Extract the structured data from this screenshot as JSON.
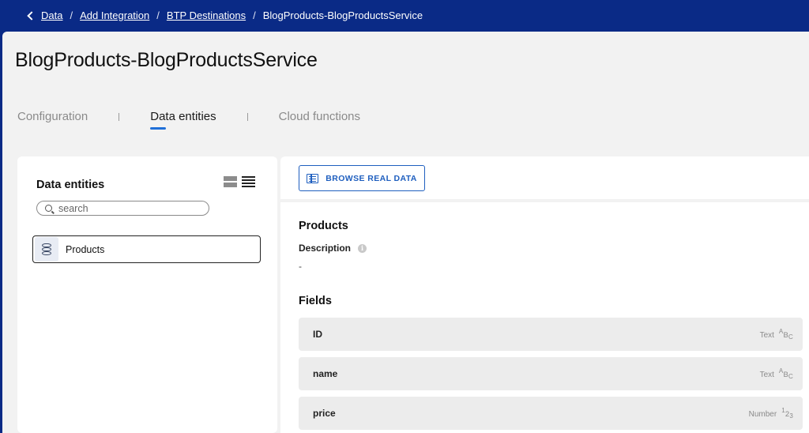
{
  "breadcrumb": {
    "items": [
      "Data",
      "Add Integration",
      "BTP Destinations"
    ],
    "current": "BlogProducts-BlogProductsService"
  },
  "page": {
    "title": "BlogProducts-BlogProductsService"
  },
  "tabs": [
    {
      "label": "Configuration",
      "active": false
    },
    {
      "label": "Data entities",
      "active": true
    },
    {
      "label": "Cloud functions",
      "active": false
    }
  ],
  "entities_panel": {
    "title": "Data entities",
    "search_placeholder": "search",
    "items": [
      {
        "label": "Products",
        "icon": "database-icon"
      }
    ]
  },
  "toolbar": {
    "browse_label": "BROWSE REAL DATA"
  },
  "entity_detail": {
    "name": "Products",
    "description_label": "Description",
    "description_value": "-",
    "fields_title": "Fields",
    "fields": [
      {
        "name": "ID",
        "type": "Text",
        "glyph": "ABC"
      },
      {
        "name": "name",
        "type": "Text",
        "glyph": "ABC"
      },
      {
        "name": "price",
        "type": "Number",
        "glyph": "123"
      }
    ]
  },
  "colors": {
    "header_bg": "#0a2a86",
    "accent": "#1f5fbf",
    "tab_indicator": "#1f6fd8",
    "page_bg": "#f2f2f2"
  }
}
